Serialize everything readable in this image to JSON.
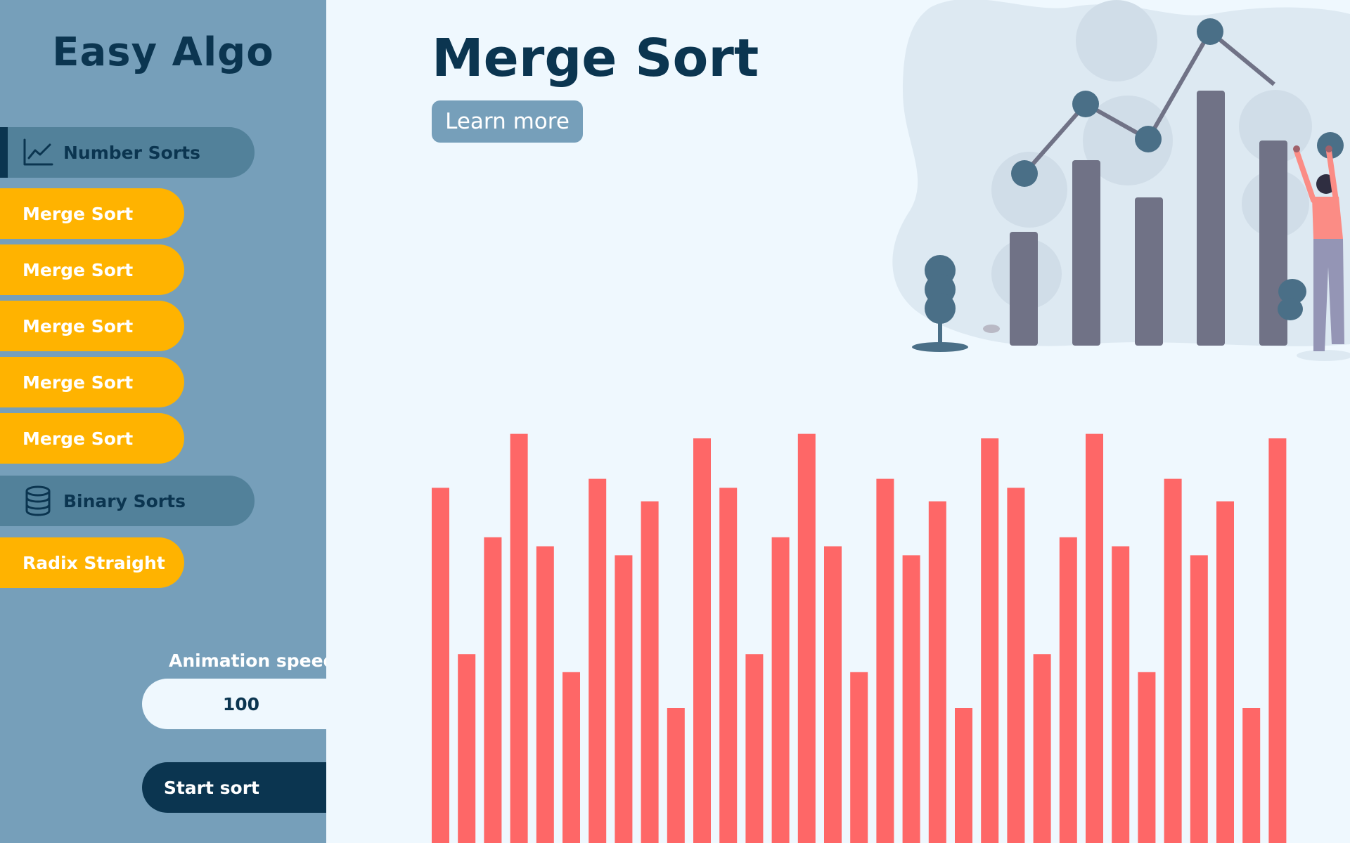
{
  "app": {
    "title": "Easy Algo"
  },
  "sidebar": {
    "sections": [
      {
        "label": "Number Sorts",
        "icon": "line-chart-icon",
        "active": true
      },
      {
        "label": "Binary Sorts",
        "icon": "database-icon",
        "active": false
      }
    ],
    "number_sorts": [
      "Merge Sort",
      "Merge Sort",
      "Merge Sort",
      "Merge Sort",
      "Merge Sort"
    ],
    "binary_sorts": [
      "Radix Straight"
    ],
    "speed_label": "Animation speed",
    "speed_value": "100",
    "start_label": "Start sort"
  },
  "main": {
    "title": "Merge Sort",
    "learn_more": "Learn more"
  },
  "colors": {
    "sidebar_bg": "#769fba",
    "section_bg": "#52819a",
    "item_bg": "#ffb300",
    "dark": "#0b3550",
    "bar": "#fe6767",
    "page_bg": "#eff8fe"
  },
  "chart_data": {
    "type": "bar",
    "values": [
      79,
      42,
      68,
      91,
      66,
      38,
      81,
      64,
      76,
      30,
      90,
      79,
      42,
      68,
      91,
      66,
      38,
      81,
      64,
      76,
      30,
      90,
      79,
      42,
      68,
      91,
      66,
      38,
      81,
      64,
      76,
      30,
      90
    ],
    "ylim": [
      0,
      100
    ],
    "color": "#fe6767"
  }
}
